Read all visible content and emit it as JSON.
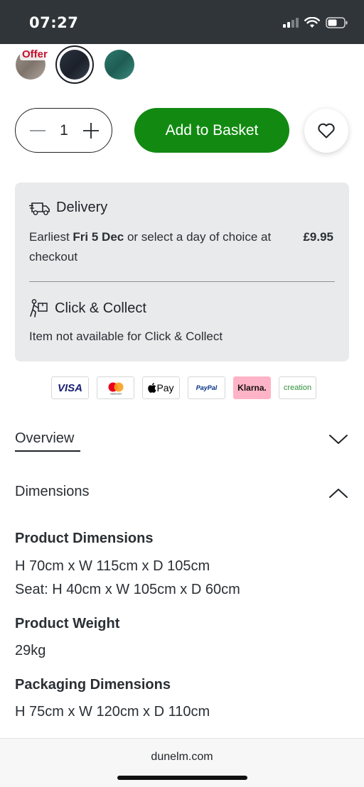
{
  "status_bar": {
    "time": "07:27"
  },
  "swatches": {
    "offer_label": "Offer"
  },
  "quantity": {
    "value": "1"
  },
  "actions": {
    "add_to_basket": "Add to Basket"
  },
  "delivery": {
    "title": "Delivery",
    "earliest_prefix": "Earliest ",
    "earliest_date": "Fri 5 Dec",
    "earliest_suffix": " or select a day of choice at checkout",
    "price": "£9.95"
  },
  "click_collect": {
    "title": "Click & Collect",
    "status": "Item not available for Click & Collect"
  },
  "payments": [
    "VISA",
    "mastercard",
    "Pay",
    "PayPal",
    "Klarna.",
    "creation"
  ],
  "accordion": {
    "overview": "Overview",
    "dimensions": "Dimensions"
  },
  "dimensions": {
    "product_heading": "Product Dimensions",
    "product_line1": "H 70cm x W 115cm x D 105cm",
    "product_line2": "Seat: H 40cm x W 105cm x D 60cm",
    "weight_heading": "Product Weight",
    "weight_value": "29kg",
    "packaging_heading": "Packaging Dimensions",
    "packaging_value": "H 75cm x W 120cm x D 110cm"
  },
  "browser": {
    "url": "dunelm.com"
  }
}
